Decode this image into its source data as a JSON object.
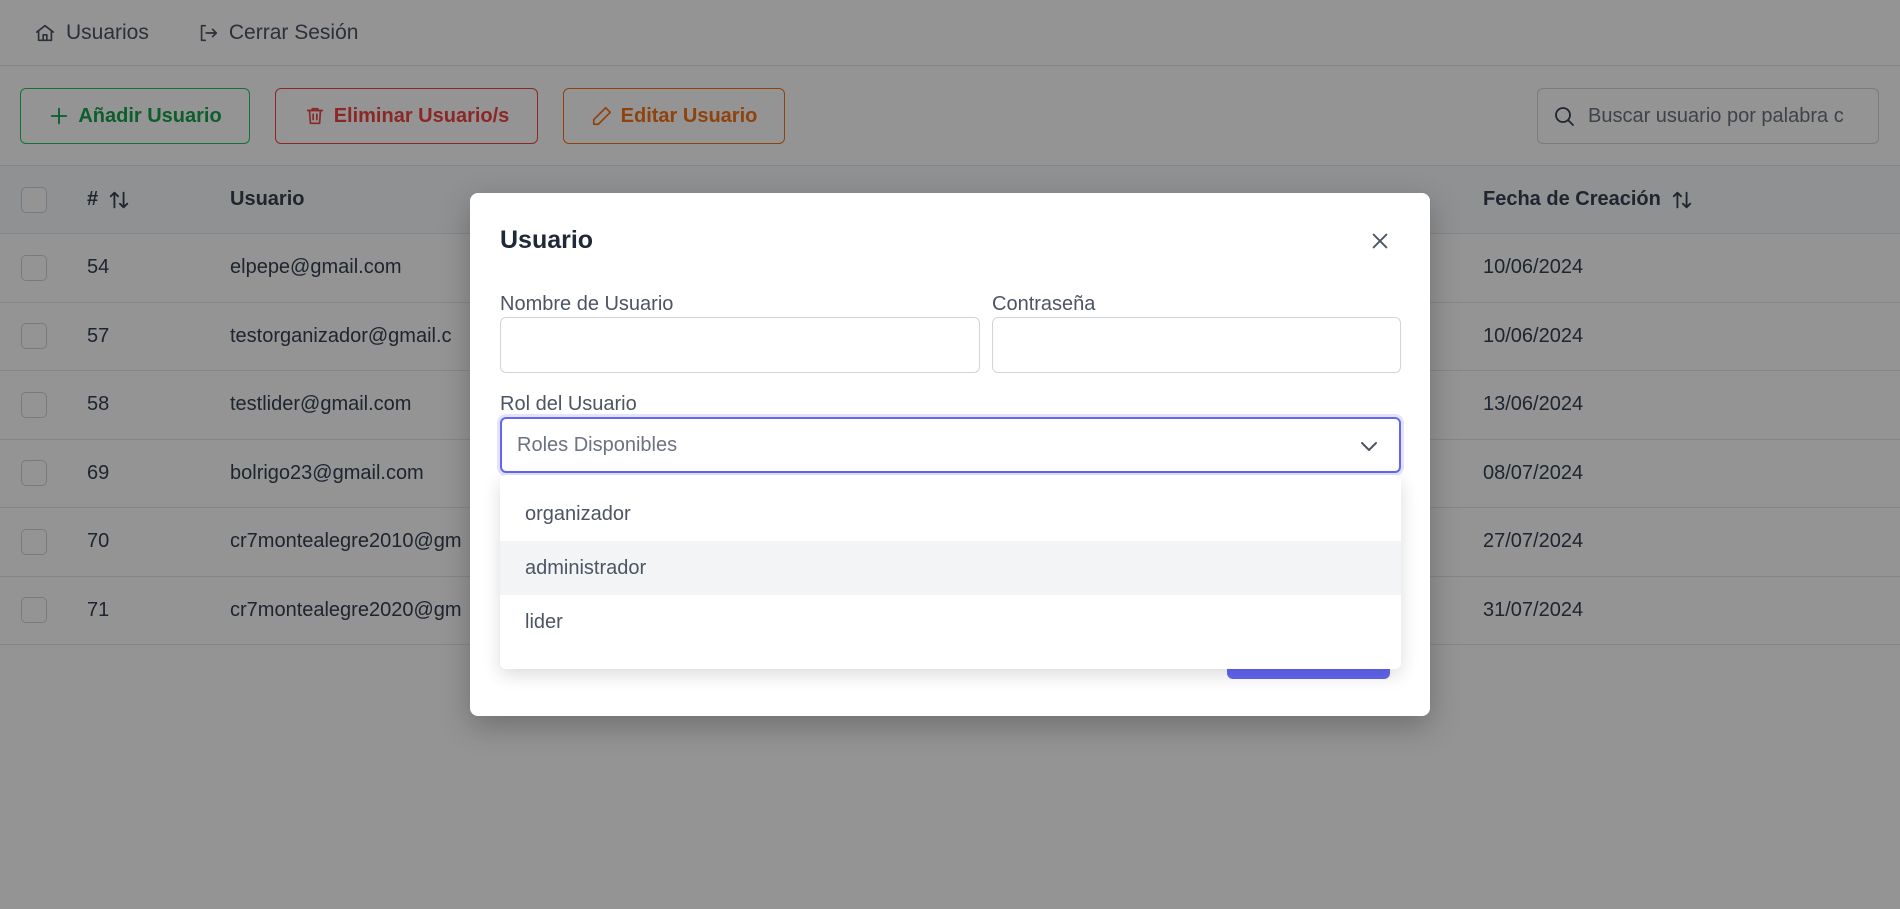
{
  "nav": {
    "items": [
      {
        "label": "Usuarios",
        "icon": "home-icon"
      },
      {
        "label": "Cerrar Sesión",
        "icon": "logout-icon"
      }
    ]
  },
  "toolbar": {
    "add_label": "Añadir Usuario",
    "delete_label": "Eliminar Usuario/s",
    "edit_label": "Editar Usuario",
    "search_placeholder": "Buscar usuario por palabra c"
  },
  "table": {
    "headers": {
      "id": "#",
      "user": "Usuario",
      "created": "Fecha de Creación"
    },
    "rows": [
      {
        "id": "54",
        "user": "elpepe@gmail.com",
        "created": "10/06/2024"
      },
      {
        "id": "57",
        "user": "testorganizador@gmail.c",
        "created": "10/06/2024"
      },
      {
        "id": "58",
        "user": "testlider@gmail.com",
        "created": "13/06/2024"
      },
      {
        "id": "69",
        "user": "bolrigo23@gmail.com",
        "created": "08/07/2024"
      },
      {
        "id": "70",
        "user": "cr7montealegre2010@gm",
        "created": "27/07/2024"
      },
      {
        "id": "71",
        "user": "cr7montealegre2020@gm",
        "created": "31/07/2024"
      }
    ]
  },
  "modal": {
    "title": "Usuario",
    "username_label": "Nombre de Usuario",
    "password_label": "Contraseña",
    "role_label": "Rol del Usuario",
    "role_placeholder": "Roles Disponibles",
    "role_options": [
      "organizador",
      "administrador",
      "lider"
    ],
    "hovered_option": "administrador"
  },
  "colors": {
    "add": "#16a34a",
    "delete": "#ef4444",
    "edit": "#f97316",
    "primary": "#6366f1"
  }
}
